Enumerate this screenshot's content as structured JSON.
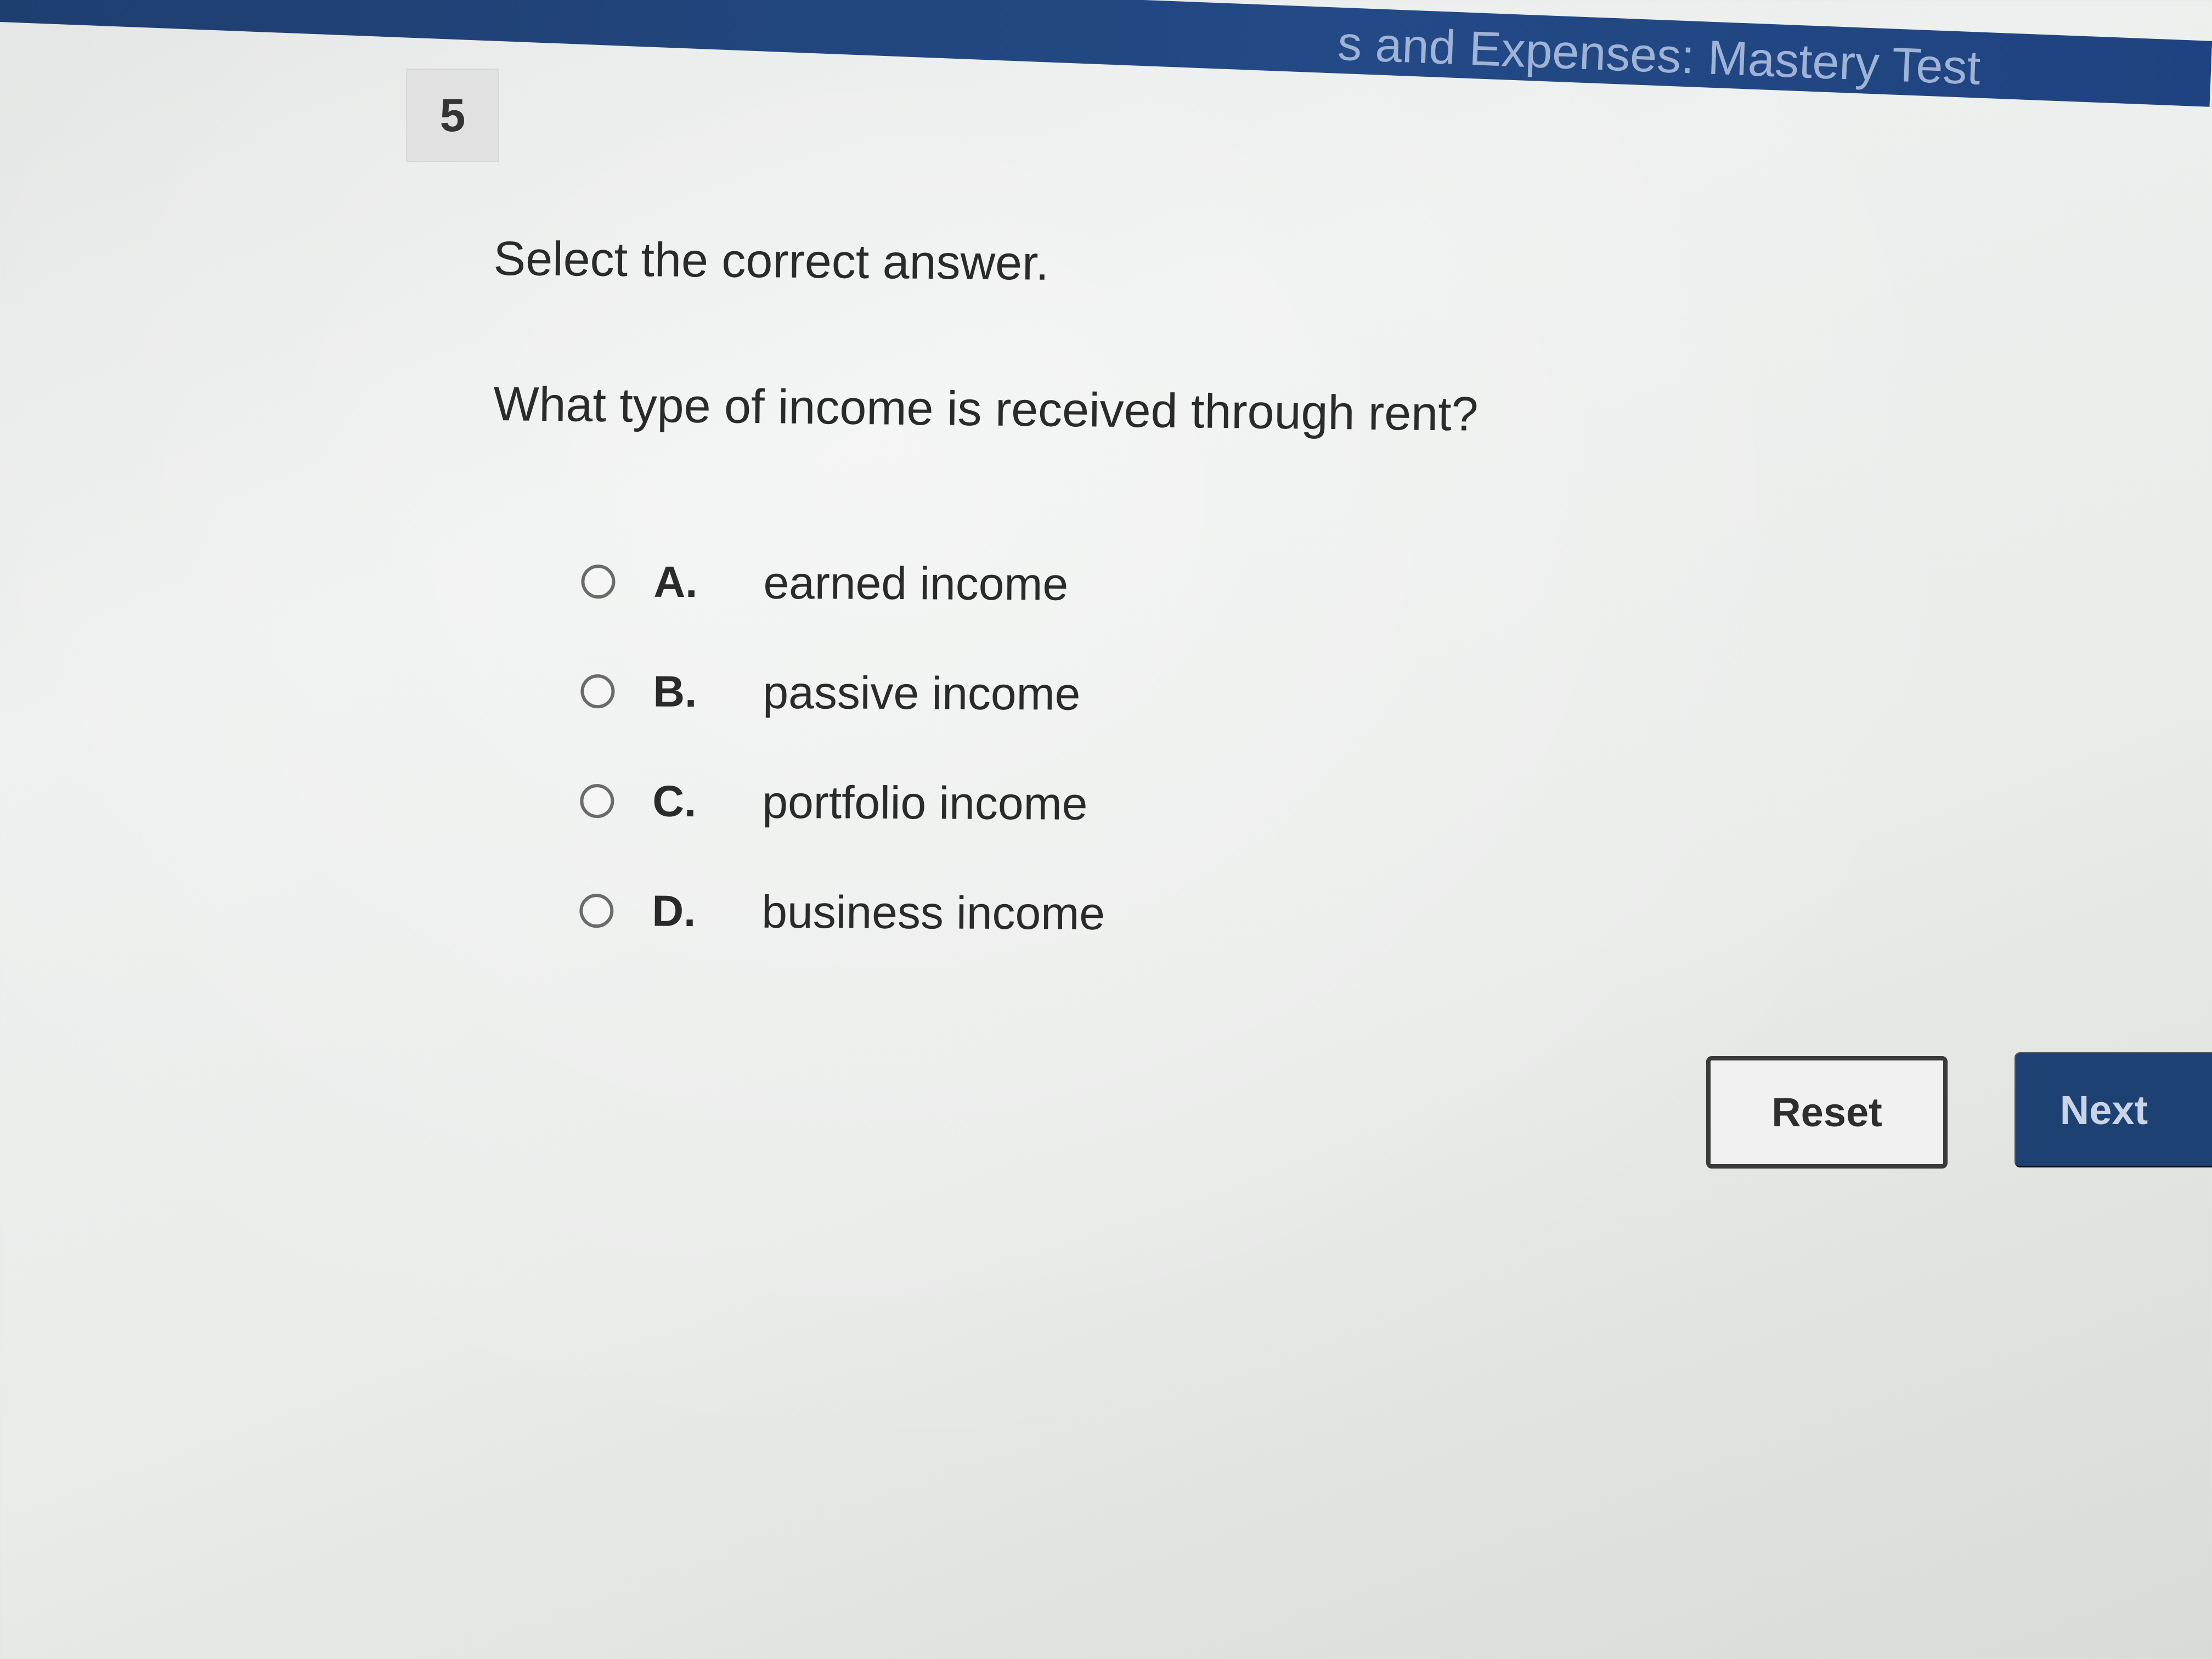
{
  "header": {
    "title": "s and Expenses: Mastery Test"
  },
  "question": {
    "number": "5",
    "instruction": "Select the correct answer.",
    "text": "What type of income is received through rent?"
  },
  "options": [
    {
      "letter": "A.",
      "text": "earned income",
      "selected": false
    },
    {
      "letter": "B.",
      "text": "passive income",
      "selected": false
    },
    {
      "letter": "C.",
      "text": "portfolio income",
      "selected": false
    },
    {
      "letter": "D.",
      "text": "business income",
      "selected": false
    }
  ],
  "buttons": {
    "reset_label": "Reset",
    "next_label": "Next"
  },
  "colors": {
    "header": "#234a86",
    "next_button": "#1d4173"
  }
}
